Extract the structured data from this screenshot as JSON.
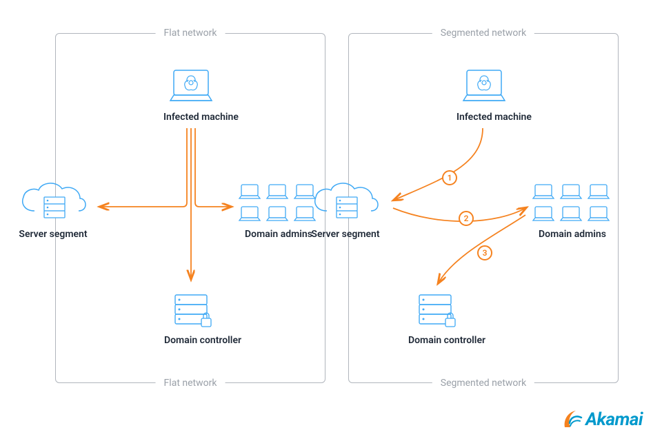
{
  "panels": {
    "left": {
      "title_top": "Flat network",
      "title_bottom": "Flat network"
    },
    "right": {
      "title_top": "Segmented network",
      "title_bottom": "Segmented  network"
    }
  },
  "nodes": {
    "infected": "Infected machine",
    "server": "Server segment",
    "admins": "Domain admins",
    "dc": "Domain controller"
  },
  "steps": [
    "1",
    "2",
    "3"
  ],
  "brand": "Akamai",
  "colors": {
    "node_stroke": "#3fa9f5",
    "arrow": "#f5821f",
    "panel_border": "#b0b5bc",
    "label": "#1f2937",
    "muted": "#9aa0a8"
  }
}
